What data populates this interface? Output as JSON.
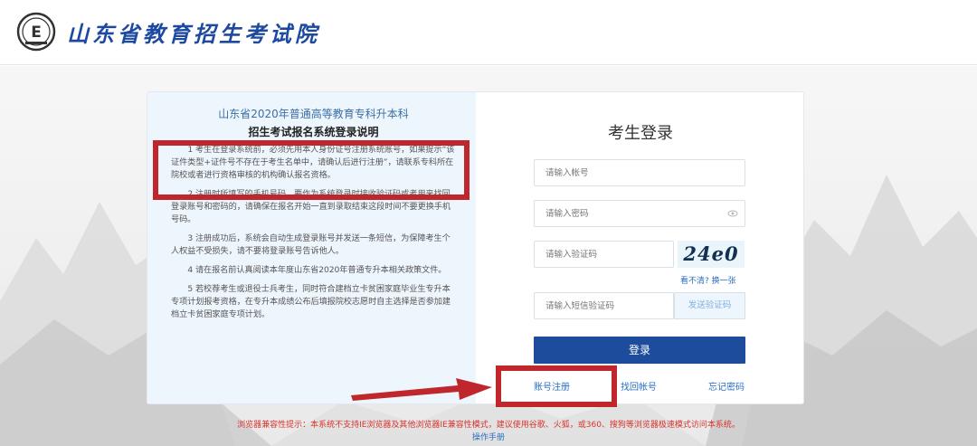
{
  "header": {
    "logo_letter": "E",
    "site_title": "山东省教育招生考试院"
  },
  "notice": {
    "title_line1": "山东省2020年普通高等教育专科升本科",
    "title_line2": "招生考试报名系统登录说明",
    "paragraphs": [
      "1 考生在登录系统前，必须先用本人身份证号注册系统账号，如果提示“该证件类型+证件号不存在于考生名单中，请确认后进行注册”，请联系专科所在院校或者进行资格审核的机构确认报名资格。",
      "2 注册时所填写的手机号码，要作为系统登录时接收验证码或者用来找回登录账号和密码的，请确保在报名开始一直到录取结束这段时间不要更换手机号码。",
      "3 注册成功后，系统会自动生成登录账号并发送一条短信，为保障考生个人权益不受损失，请不要将登录账号告诉他人。",
      "4 请在报名前认真阅读本年度山东省2020年普通专升本相关政策文件。",
      "5 若校荐考生或退役士兵考生，同时符合建档立卡贫困家庭毕业生专升本专项计划报考资格，在专升本成绩公布后填报院校志愿时自主选择是否参加建档立卡贫困家庭专项计划。"
    ]
  },
  "login": {
    "title": "考生登录",
    "account_placeholder": "请输入帐号",
    "password_placeholder": "请输入密码",
    "captcha_placeholder": "请输入验证码",
    "captcha_text": "24e0",
    "captcha_refresh": "看不清? 换一张",
    "sms_placeholder": "请输入短信验证码",
    "sms_button": "发送验证码",
    "login_button": "登录",
    "register_link": "账号注册",
    "find_account_link": "找回帐号",
    "forgot_password_link": "忘记密码"
  },
  "footer": {
    "compat_notice": "浏览器兼容性提示：本系统不支持IE浏览器及其他浏览器IE兼容性模式，建议使用谷歌、火狐，或360、搜狗等浏览器极速模式访问本系统。",
    "manual_link": "操作手册"
  },
  "colors": {
    "brand_blue": "#1d4c9c",
    "link_blue": "#2b6fc0",
    "annotation_red": "#c0272d",
    "warning_red": "#d9332e",
    "notice_bg": "#eef6fd"
  },
  "icons": {
    "logo": "exam-emblem-icon",
    "password_toggle": "eye-icon",
    "annotation_arrow": "arrow-right-icon"
  }
}
